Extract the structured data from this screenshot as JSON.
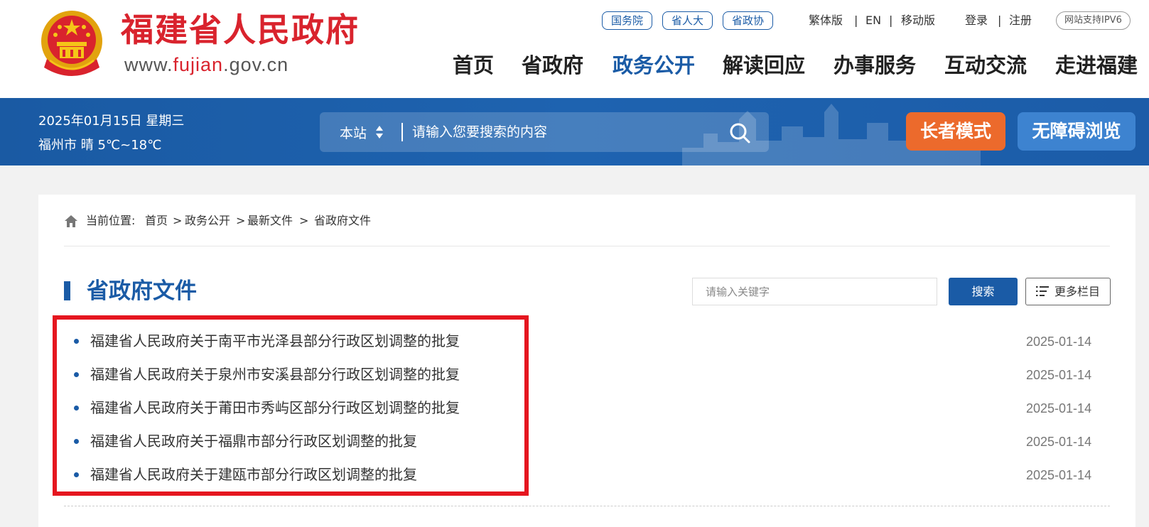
{
  "header": {
    "site_name": "福建省人民政府",
    "url_parts": [
      "www.",
      "fujian",
      ".gov.cn"
    ],
    "tag_links": [
      "国务院",
      "省人大",
      "省政协"
    ],
    "lang_links": [
      "繁体版",
      "EN",
      "移动版"
    ],
    "account_links": [
      "登录",
      "注册"
    ],
    "separator": "|",
    "ipv6_badge": "网站支持IPV6",
    "nav": [
      "首页",
      "省政府",
      "政务公开",
      "解读回应",
      "办事服务",
      "互动交流",
      "走进福建"
    ],
    "active_nav": "政务公开"
  },
  "bluebar": {
    "date": "2025年01月15日 星期三",
    "weather": "福州市 晴 5℃~18℃",
    "search_scope": "本站",
    "search_placeholder": "请输入您要搜索的内容",
    "elder_mode": "长者模式",
    "accessible": "无障碍浏览"
  },
  "breadcrumb": {
    "prefix": "当前位置:",
    "items": [
      "首页",
      "政务公开",
      "最新文件",
      "省政府文件"
    ],
    "separator": ">"
  },
  "section": {
    "title": "省政府文件",
    "keyword_placeholder": "请输入关键字",
    "search_label": "搜索",
    "more_label": "更多栏目"
  },
  "documents": [
    {
      "title": "福建省人民政府关于南平市光泽县部分行政区划调整的批复",
      "date": "2025-01-14"
    },
    {
      "title": "福建省人民政府关于泉州市安溪县部分行政区划调整的批复",
      "date": "2025-01-14"
    },
    {
      "title": "福建省人民政府关于莆田市秀屿区部分行政区划调整的批复",
      "date": "2025-01-14"
    },
    {
      "title": "福建省人民政府关于福鼎市部分行政区划调整的批复",
      "date": "2025-01-14"
    },
    {
      "title": "福建省人民政府关于建瓯市部分行政区划调整的批复",
      "date": "2025-01-14"
    }
  ],
  "colors": {
    "brand_red": "#d9232d",
    "brand_blue": "#1a5ba6",
    "elder_orange": "#ec6a2c",
    "accessible_blue": "#3d83d0",
    "highlight_red": "#e5161f"
  },
  "icons": [
    "national-emblem-icon",
    "sort-arrows-icon",
    "search-icon",
    "home-icon",
    "list-icon"
  ]
}
